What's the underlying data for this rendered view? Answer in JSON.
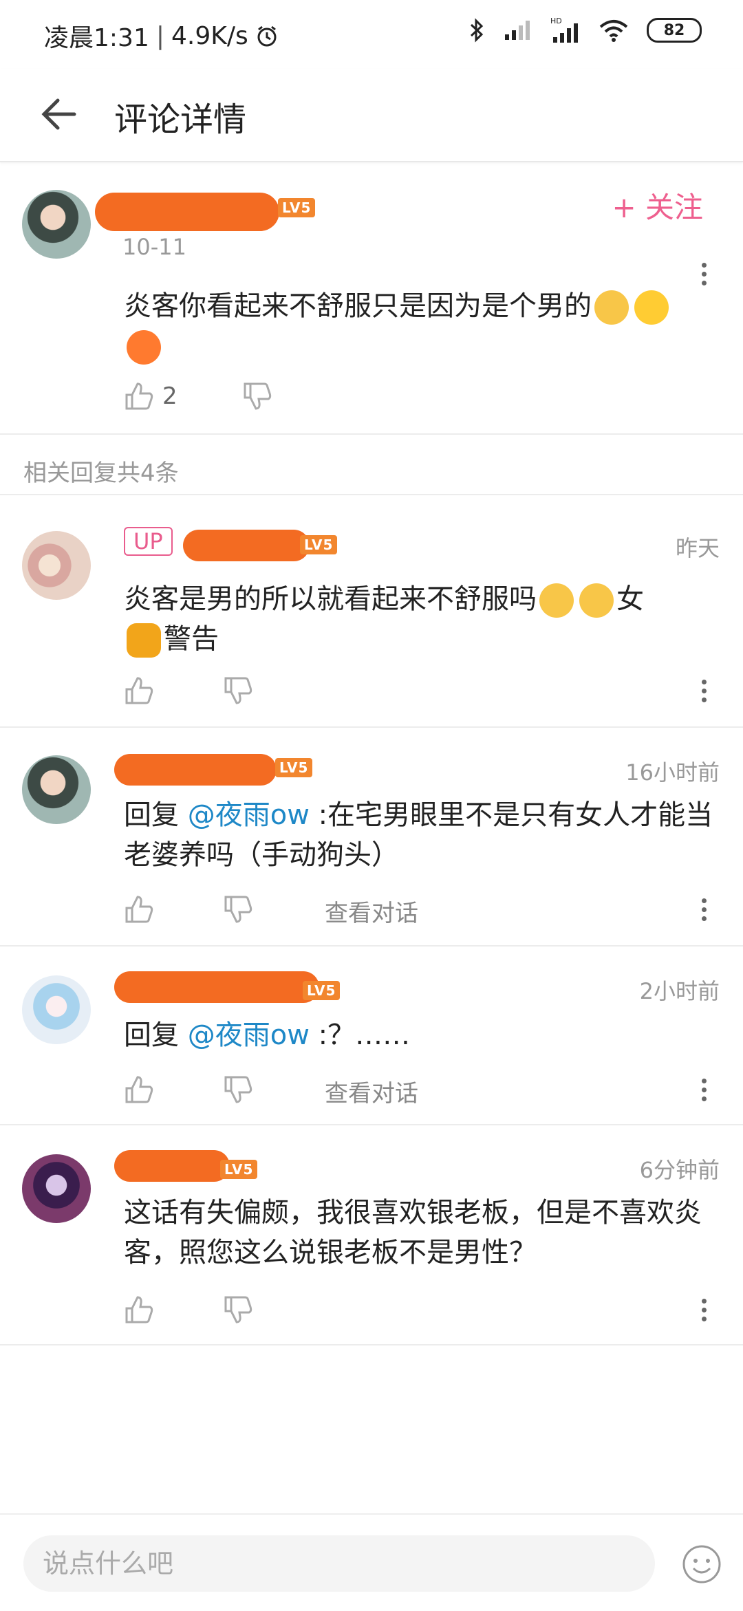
{
  "status_bar": {
    "time": "凌晨1:31",
    "separator": "|",
    "speed": "4.9K/s",
    "battery": "82"
  },
  "header": {
    "title": "评论详情"
  },
  "main_comment": {
    "date": "10-11",
    "level": "LV5",
    "follow_label": "+ 关注",
    "text": "炎客你看起来不舒服只是因为是个男的",
    "like_count": "2"
  },
  "replies_header": "相关回复共4条",
  "replies": [
    {
      "up_badge": "UP",
      "level": "LV5",
      "time": "昨天",
      "text_a": "炎客是男的所以就看起来不舒服吗",
      "text_b": "女",
      "text_c": "警告"
    },
    {
      "level": "LV5",
      "time": "16小时前",
      "reply_prefix": "回复 ",
      "mention": "@夜雨ow",
      "text": " :在宅男眼里不是只有女人才能当老婆养吗（手动狗头）",
      "view_conversation": "查看对话"
    },
    {
      "level": "LV5",
      "time": "2小时前",
      "reply_prefix": "回复 ",
      "mention": "@夜雨ow",
      "text": " :？……",
      "view_conversation": "查看对话"
    },
    {
      "level": "LV5",
      "time": "6分钟前",
      "text": "这话有失偏颇，我很喜欢银老板，但是不喜欢炎客，照您这么说银老板不是男性？"
    }
  ],
  "input": {
    "placeholder": "说点什么吧"
  },
  "colors": {
    "accent_pink": "#ee5f8e",
    "mention_blue": "#1e88c7",
    "redaction_orange": "#f36b22",
    "level_badge": "#f2862e"
  }
}
